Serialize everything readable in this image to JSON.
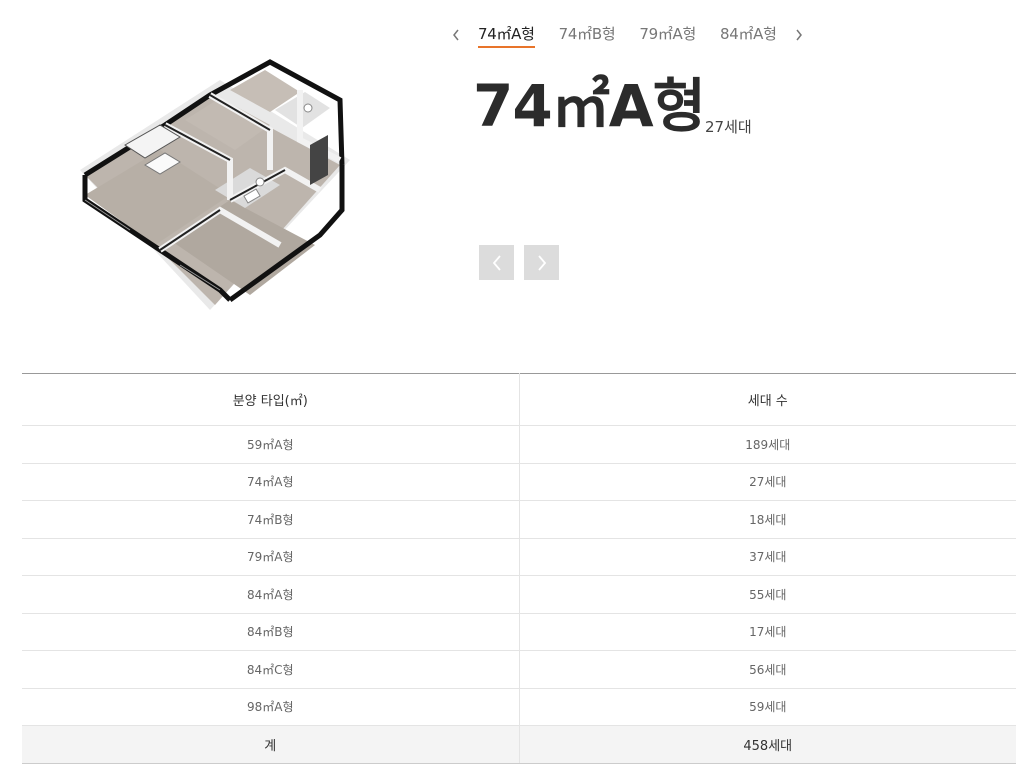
{
  "plan_tabs": {
    "prev_icon": "chevron-left-icon",
    "next_icon": "chevron-right-icon",
    "items": [
      "74㎡A형",
      "74㎡B형",
      "79㎡A형",
      "84㎡A형"
    ],
    "active_index": 0
  },
  "detail": {
    "title": "74㎡A형",
    "units": "27세대"
  },
  "gallery_nav": {
    "prev_icon": "chevron-left-icon",
    "next_icon": "chevron-right-icon"
  },
  "table": {
    "headers": [
      "분양 타입(㎡)",
      "세대 수"
    ],
    "rows": [
      [
        "59㎡A형",
        "189세대"
      ],
      [
        "74㎡A형",
        "27세대"
      ],
      [
        "74㎡B형",
        "18세대"
      ],
      [
        "79㎡A형",
        "37세대"
      ],
      [
        "84㎡A형",
        "55세대"
      ],
      [
        "84㎡B형",
        "17세대"
      ],
      [
        "84㎡C형",
        "56세대"
      ],
      [
        "98㎡A형",
        "59세대"
      ]
    ],
    "total": [
      "계",
      "458세대"
    ]
  },
  "colors": {
    "accent": "#e8742a",
    "nav_button_bg": "#dcdcdc",
    "title_color": "#2b2b2b"
  }
}
